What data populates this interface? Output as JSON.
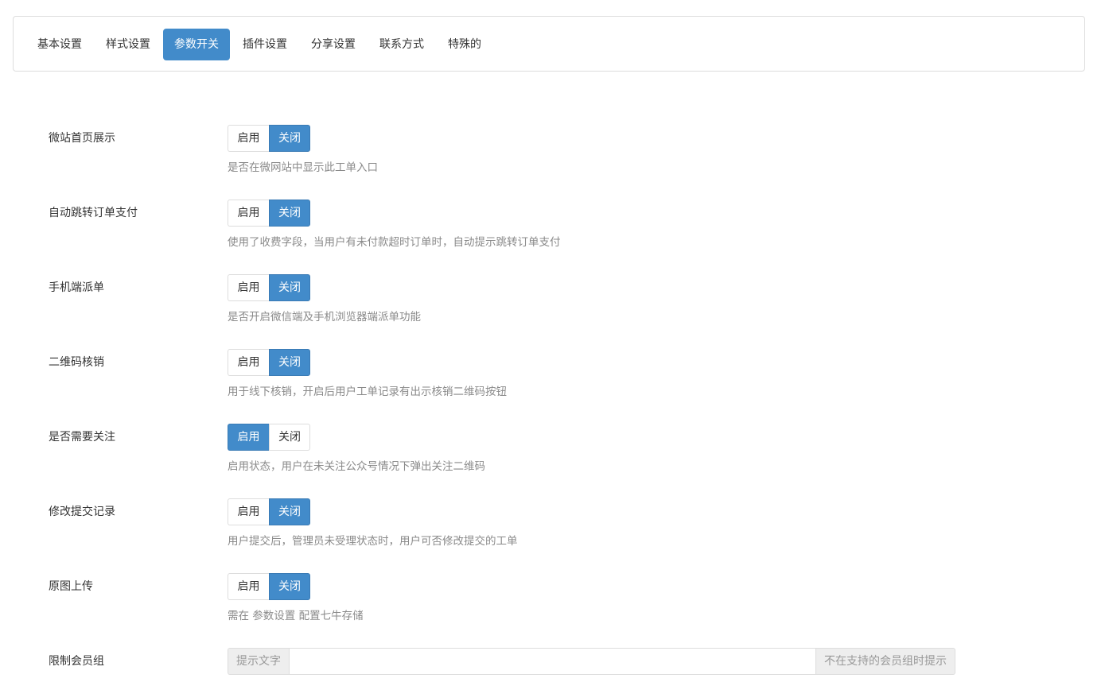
{
  "tabs": [
    {
      "label": "基本设置",
      "active": false
    },
    {
      "label": "样式设置",
      "active": false
    },
    {
      "label": "参数开关",
      "active": true
    },
    {
      "label": "插件设置",
      "active": false
    },
    {
      "label": "分享设置",
      "active": false
    },
    {
      "label": "联系方式",
      "active": false
    },
    {
      "label": "特殊的",
      "active": false
    }
  ],
  "toggle_labels": {
    "on": "启用",
    "off": "关闭"
  },
  "settings": [
    {
      "label": "微站首页展示",
      "value": "off",
      "help": "是否在微网站中显示此工单入口"
    },
    {
      "label": "自动跳转订单支付",
      "value": "off",
      "help": "使用了收费字段，当用户有未付款超时订单时，自动提示跳转订单支付"
    },
    {
      "label": "手机端派单",
      "value": "off",
      "help": "是否开启微信端及手机浏览器端派单功能"
    },
    {
      "label": "二维码核销",
      "value": "off",
      "help": "用于线下核销，开启后用户工单记录有出示核销二维码按钮"
    },
    {
      "label": "是否需要关注",
      "value": "on",
      "help": "启用状态，用户在未关注公众号情况下弹出关注二维码"
    },
    {
      "label": "修改提交记录",
      "value": "off",
      "help": "用户提交后，管理员未受理状态时，用户可否修改提交的工单"
    },
    {
      "label": "原图上传",
      "value": "off",
      "help": "需在 参数设置 配置七牛存储"
    }
  ],
  "member_group": {
    "label": "限制会员组",
    "prefix": "提示文字",
    "value": "",
    "suffix": "不在支持的会员组时提示"
  },
  "colors": {
    "primary": "#428bca",
    "help_text": "#8a8a8a",
    "border": "#dddddd"
  }
}
